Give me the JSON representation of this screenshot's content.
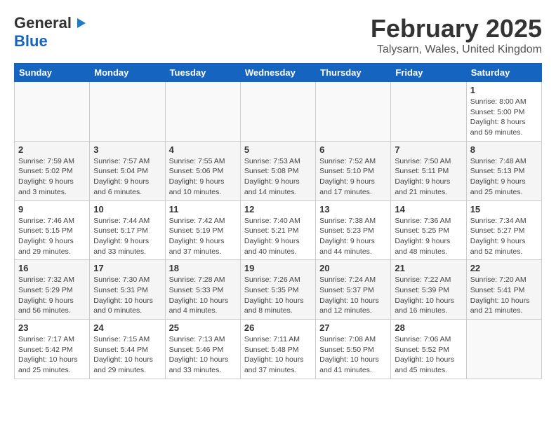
{
  "header": {
    "logo_general": "General",
    "logo_blue": "Blue",
    "month_title": "February 2025",
    "location": "Talysarn, Wales, United Kingdom"
  },
  "weekdays": [
    "Sunday",
    "Monday",
    "Tuesday",
    "Wednesday",
    "Thursday",
    "Friday",
    "Saturday"
  ],
  "weeks": [
    [
      {
        "day": "",
        "info": ""
      },
      {
        "day": "",
        "info": ""
      },
      {
        "day": "",
        "info": ""
      },
      {
        "day": "",
        "info": ""
      },
      {
        "day": "",
        "info": ""
      },
      {
        "day": "",
        "info": ""
      },
      {
        "day": "1",
        "info": "Sunrise: 8:00 AM\nSunset: 5:00 PM\nDaylight: 8 hours and 59 minutes."
      }
    ],
    [
      {
        "day": "2",
        "info": "Sunrise: 7:59 AM\nSunset: 5:02 PM\nDaylight: 9 hours and 3 minutes."
      },
      {
        "day": "3",
        "info": "Sunrise: 7:57 AM\nSunset: 5:04 PM\nDaylight: 9 hours and 6 minutes."
      },
      {
        "day": "4",
        "info": "Sunrise: 7:55 AM\nSunset: 5:06 PM\nDaylight: 9 hours and 10 minutes."
      },
      {
        "day": "5",
        "info": "Sunrise: 7:53 AM\nSunset: 5:08 PM\nDaylight: 9 hours and 14 minutes."
      },
      {
        "day": "6",
        "info": "Sunrise: 7:52 AM\nSunset: 5:10 PM\nDaylight: 9 hours and 17 minutes."
      },
      {
        "day": "7",
        "info": "Sunrise: 7:50 AM\nSunset: 5:11 PM\nDaylight: 9 hours and 21 minutes."
      },
      {
        "day": "8",
        "info": "Sunrise: 7:48 AM\nSunset: 5:13 PM\nDaylight: 9 hours and 25 minutes."
      }
    ],
    [
      {
        "day": "9",
        "info": "Sunrise: 7:46 AM\nSunset: 5:15 PM\nDaylight: 9 hours and 29 minutes."
      },
      {
        "day": "10",
        "info": "Sunrise: 7:44 AM\nSunset: 5:17 PM\nDaylight: 9 hours and 33 minutes."
      },
      {
        "day": "11",
        "info": "Sunrise: 7:42 AM\nSunset: 5:19 PM\nDaylight: 9 hours and 37 minutes."
      },
      {
        "day": "12",
        "info": "Sunrise: 7:40 AM\nSunset: 5:21 PM\nDaylight: 9 hours and 40 minutes."
      },
      {
        "day": "13",
        "info": "Sunrise: 7:38 AM\nSunset: 5:23 PM\nDaylight: 9 hours and 44 minutes."
      },
      {
        "day": "14",
        "info": "Sunrise: 7:36 AM\nSunset: 5:25 PM\nDaylight: 9 hours and 48 minutes."
      },
      {
        "day": "15",
        "info": "Sunrise: 7:34 AM\nSunset: 5:27 PM\nDaylight: 9 hours and 52 minutes."
      }
    ],
    [
      {
        "day": "16",
        "info": "Sunrise: 7:32 AM\nSunset: 5:29 PM\nDaylight: 9 hours and 56 minutes."
      },
      {
        "day": "17",
        "info": "Sunrise: 7:30 AM\nSunset: 5:31 PM\nDaylight: 10 hours and 0 minutes."
      },
      {
        "day": "18",
        "info": "Sunrise: 7:28 AM\nSunset: 5:33 PM\nDaylight: 10 hours and 4 minutes."
      },
      {
        "day": "19",
        "info": "Sunrise: 7:26 AM\nSunset: 5:35 PM\nDaylight: 10 hours and 8 minutes."
      },
      {
        "day": "20",
        "info": "Sunrise: 7:24 AM\nSunset: 5:37 PM\nDaylight: 10 hours and 12 minutes."
      },
      {
        "day": "21",
        "info": "Sunrise: 7:22 AM\nSunset: 5:39 PM\nDaylight: 10 hours and 16 minutes."
      },
      {
        "day": "22",
        "info": "Sunrise: 7:20 AM\nSunset: 5:41 PM\nDaylight: 10 hours and 21 minutes."
      }
    ],
    [
      {
        "day": "23",
        "info": "Sunrise: 7:17 AM\nSunset: 5:42 PM\nDaylight: 10 hours and 25 minutes."
      },
      {
        "day": "24",
        "info": "Sunrise: 7:15 AM\nSunset: 5:44 PM\nDaylight: 10 hours and 29 minutes."
      },
      {
        "day": "25",
        "info": "Sunrise: 7:13 AM\nSunset: 5:46 PM\nDaylight: 10 hours and 33 minutes."
      },
      {
        "day": "26",
        "info": "Sunrise: 7:11 AM\nSunset: 5:48 PM\nDaylight: 10 hours and 37 minutes."
      },
      {
        "day": "27",
        "info": "Sunrise: 7:08 AM\nSunset: 5:50 PM\nDaylight: 10 hours and 41 minutes."
      },
      {
        "day": "28",
        "info": "Sunrise: 7:06 AM\nSunset: 5:52 PM\nDaylight: 10 hours and 45 minutes."
      },
      {
        "day": "",
        "info": ""
      }
    ]
  ]
}
